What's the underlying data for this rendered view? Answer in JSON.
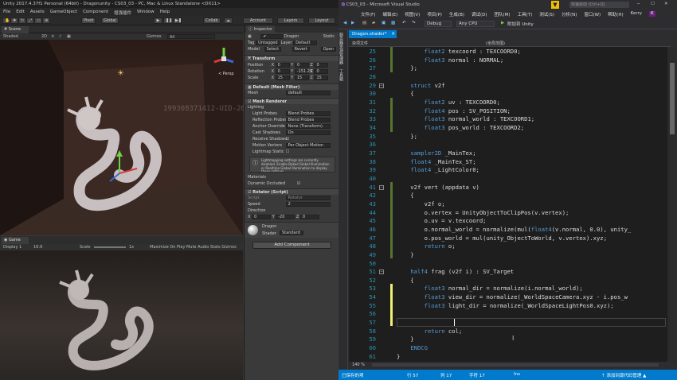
{
  "unity": {
    "title": "Unity 2017.4.37f1 Personal (64bit) - Dragonunity - CS03_03 - PC, Mac & Linux Standalone <DX11>",
    "menu": [
      "File",
      "Edit",
      "Assets",
      "GameObject",
      "Component",
      "增强插件",
      "Window",
      "Help"
    ],
    "toolbar": {
      "pivot": "Pivot",
      "global": "Global",
      "collab": "Collab",
      "account": "Account",
      "layers": "Layers",
      "layout": "Layout"
    },
    "scene": {
      "tab": "Scene",
      "shading": "Shaded",
      "mode": "2D",
      "gizmos": "Gizmos",
      "search": "All",
      "persp": "< Persp"
    },
    "game": {
      "tab": "Game",
      "display": "Display 1",
      "aspect": "16:9",
      "scale_label": "Scale",
      "scale_value": "1x",
      "controls": "Maximize On Play   Mute Audio   Stats   Gizmos"
    },
    "watermark": "199308371412-UID-20393"
  },
  "inspector": {
    "tab": "Inspector",
    "object_name": "Dragon",
    "static": "Static",
    "tag_label": "Tag",
    "tag_value": "Untagged",
    "layer_label": "Layer",
    "layer_value": "Default",
    "model_label": "Model",
    "select": "Select",
    "revert": "Revert",
    "open": "Open",
    "transform": "Transform",
    "position": {
      "label": "Position",
      "x": "0",
      "y": "0",
      "z": "0"
    },
    "rotation": {
      "label": "Rotation",
      "x": "0",
      "y": "-151.29",
      "z": "0"
    },
    "scale": {
      "label": "Scale",
      "x": "15",
      "y": "15",
      "z": "15"
    },
    "mesh_filter": "Default (Mesh Filter)",
    "mesh_label": "Mesh",
    "mesh_value": "default",
    "mesh_renderer": "Mesh Renderer",
    "lighting": "Lighting",
    "light_probes": {
      "label": "Light Probes",
      "value": "Blend Probes"
    },
    "reflection_probes": {
      "label": "Reflection Probes",
      "value": "Blend Probes"
    },
    "anchor_override": {
      "label": "Anchor Override",
      "value": "None (Transform)"
    },
    "cast_shadows": {
      "label": "Cast Shadows",
      "value": "On"
    },
    "receive_shadows": "Receive Shadows",
    "motion_vectors": {
      "label": "Motion Vectors",
      "value": "Per Object Motion"
    },
    "lightmap_static": "Lightmap Static",
    "info": "Lightmapping settings are currently disabled. Enable Baked Global Illumination or Realtime Global Illumination to display these settings.",
    "materials": "Materials",
    "dynamic_occluded": "Dynamic Occluded",
    "rotator": "Rotator (Script)",
    "script_label": "Script",
    "script_value": "Rotator",
    "speed_label": "Speed",
    "speed_value": "2",
    "direction_label": "Direction",
    "direction": {
      "x": "0",
      "y": "-20",
      "z": "0"
    },
    "material_name": "Dragon",
    "shader_label": "Shader",
    "shader_value": "Standard",
    "add_component": "Add Component"
  },
  "vs": {
    "title": "CS03_03 - Microsoft Visual Studio",
    "search": "快速启动 (Ctrl+Q)",
    "user": "Kerry",
    "menu": [
      "文件(F)",
      "编辑(E)",
      "视图(V)",
      "项目(P)",
      "生成(B)",
      "调试(D)",
      "团队(M)",
      "工具(T)",
      "测试(S)",
      "分析(N)",
      "窗口(W)",
      "帮助(H)"
    ],
    "toolbar": {
      "config": "Debug",
      "platform": "Any CPU",
      "attach": "附加到 Unity"
    },
    "doc_tab": "Dragon.shader*",
    "nav_left": "杂项文件",
    "nav_right": "(全局范围)",
    "side_labels": [
      "服务器资源管理器",
      "工具箱"
    ],
    "lines": [
      {
        "n": "25",
        "t": "        float2 texcoord : TEXCOORD0;"
      },
      {
        "n": "26",
        "t": "        float3 normal : NORMAL;"
      },
      {
        "n": "27",
        "t": "    };"
      },
      {
        "n": "28",
        "t": ""
      },
      {
        "n": "29",
        "t": "    struct v2f"
      },
      {
        "n": "30",
        "t": "    {"
      },
      {
        "n": "31",
        "t": "        float2 uv : TEXCOORD0;"
      },
      {
        "n": "32",
        "t": "        float4 pos : SV_POSITION;"
      },
      {
        "n": "33",
        "t": "        float3 normal_world : TEXCOORD1;"
      },
      {
        "n": "34",
        "t": "        float3 pos_world : TEXCOORD2;"
      },
      {
        "n": "35",
        "t": "    };"
      },
      {
        "n": "36",
        "t": ""
      },
      {
        "n": "37",
        "t": "    sampler2D _MainTex;"
      },
      {
        "n": "38",
        "t": "    float4 _MainTex_ST;"
      },
      {
        "n": "39",
        "t": "    float4 _LightColor0;"
      },
      {
        "n": "40",
        "t": ""
      },
      {
        "n": "41",
        "t": "    v2f vert (appdata v)"
      },
      {
        "n": "42",
        "t": "    {"
      },
      {
        "n": "43",
        "t": "        v2f o;"
      },
      {
        "n": "44",
        "t": "        o.vertex = UnityObjectToClipPos(v.vertex);"
      },
      {
        "n": "45",
        "t": "        o.uv = v.texcoord;"
      },
      {
        "n": "46",
        "t": "        o.normal_world = normalize(mul(float4(v.normal, 0.0), unity_"
      },
      {
        "n": "47",
        "t": "        o.pos_world = mul(unity_ObjectToWorld, v.vertex).xyz;"
      },
      {
        "n": "48",
        "t": "        return o;"
      },
      {
        "n": "49",
        "t": "    }"
      },
      {
        "n": "50",
        "t": ""
      },
      {
        "n": "51",
        "t": "    half4 frag (v2f i) : SV_Target"
      },
      {
        "n": "52",
        "t": "    {"
      },
      {
        "n": "53",
        "t": "        float3 normal_dir = normalize(i.normal_world);"
      },
      {
        "n": "54",
        "t": "        float3 view_dir = normalize(_WorldSpaceCamera.xyz - i.pos_w"
      },
      {
        "n": "55",
        "t": "        float3 light_dir = normalize(_WorldSpaceLightPos0.xyz);"
      },
      {
        "n": "56",
        "t": ""
      },
      {
        "n": "57",
        "t": "        "
      },
      {
        "n": "58",
        "t": "        return col;"
      },
      {
        "n": "59",
        "t": "    }"
      },
      {
        "n": "60",
        "t": "    ENDCG"
      },
      {
        "n": "61",
        "t": "}"
      }
    ],
    "zoom": "140 %",
    "status": {
      "ready": "已保存的项",
      "row": "行 57",
      "col": "列 17",
      "char": "字符 17",
      "ins": "Ins",
      "right": "↑ 添加到源代码管理 ▲"
    }
  },
  "colors": {
    "vs_accent": "#007acc",
    "unity_bg": "#383838",
    "editor_bg": "#1e1e1e"
  }
}
